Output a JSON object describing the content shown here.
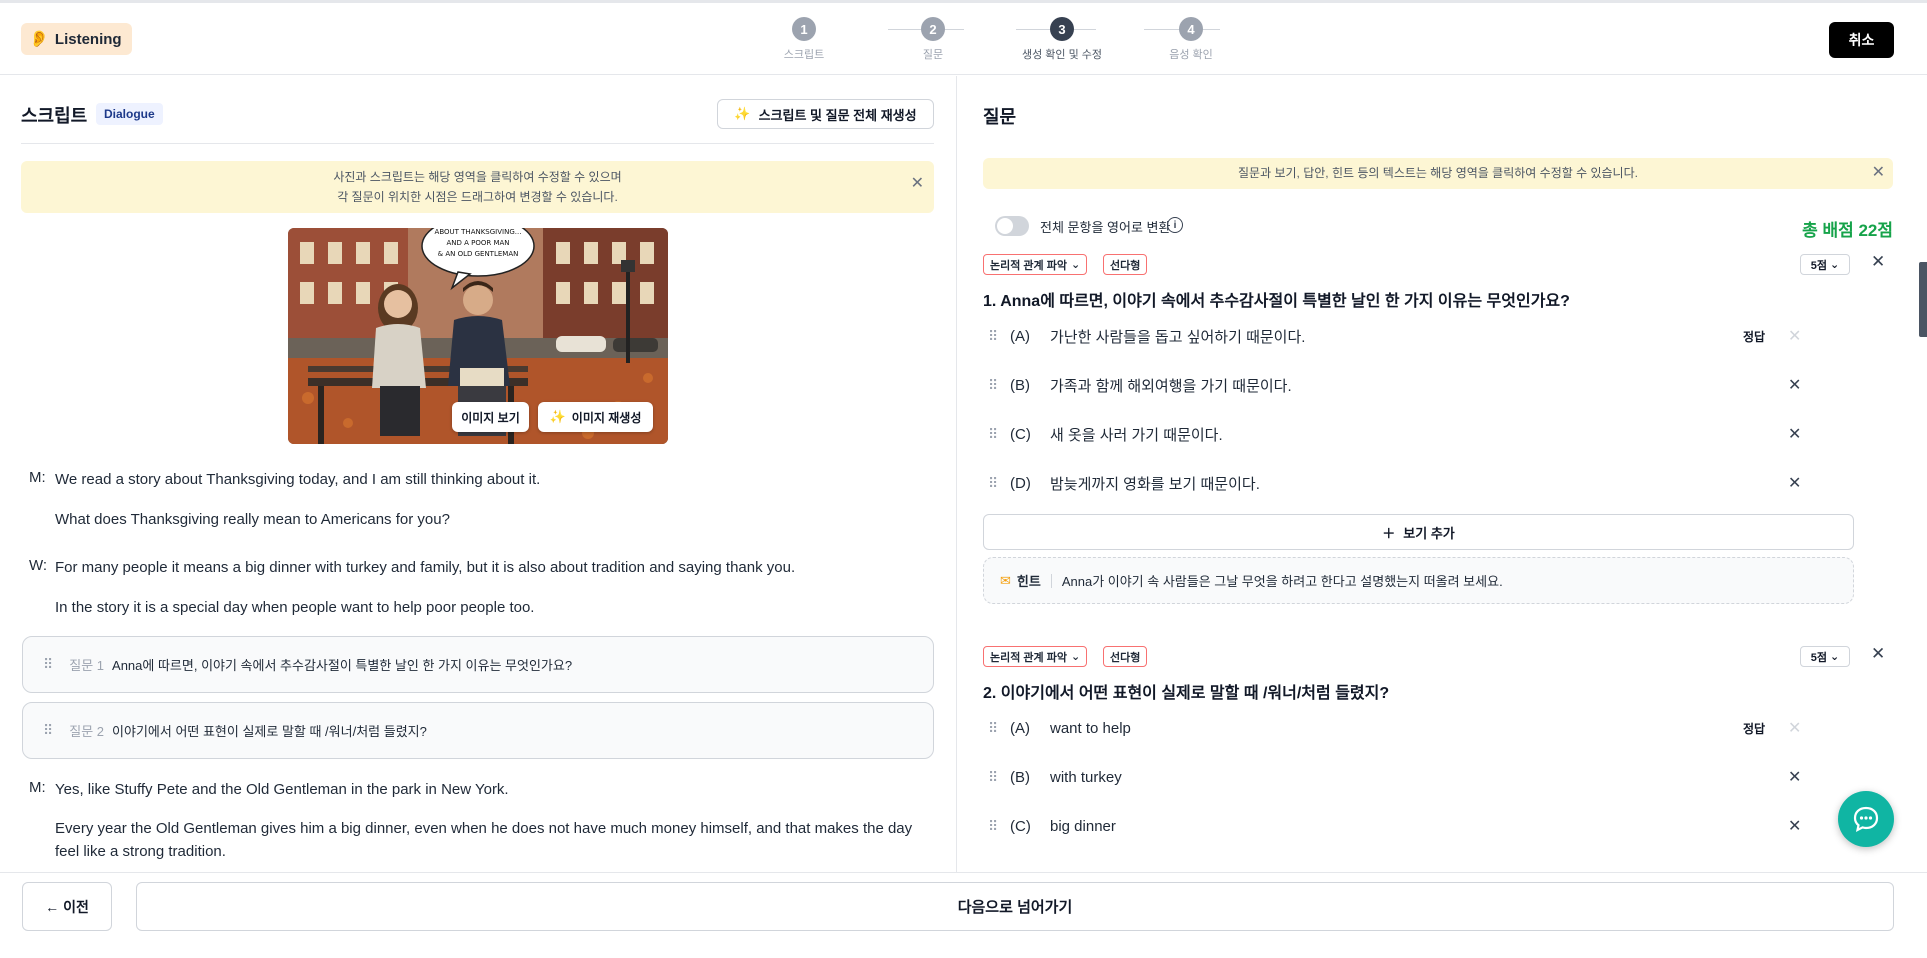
{
  "header": {
    "mode_label": "Listening",
    "steps": [
      {
        "num": "1",
        "label": "스크립트"
      },
      {
        "num": "2",
        "label": "질문"
      },
      {
        "num": "3",
        "label": "생성 확인 및 수정"
      },
      {
        "num": "4",
        "label": "음성 확인"
      }
    ],
    "current_step": 3,
    "cancel_label": "취소"
  },
  "script": {
    "title": "스크립트",
    "type_badge": "Dialogue",
    "regen_all_label": "스크립트 및 질문 전체 재생성",
    "notice_line1": "사진과 스크립트는 해당 영역을 클릭하여 수정할 수 있으며",
    "notice_line2": "각 질문이 위치한 시점은 드래그하여 변경할 수 있습니다.",
    "image": {
      "speech_bubble": [
        "ABOUT THANKSGIVING...",
        "AND A POOR MAN",
        "& AN OLD GENTLEMAN"
      ],
      "view_label": "이미지 보기",
      "regen_label": "이미지 재생성"
    },
    "lines": [
      {
        "speaker": "M:",
        "text": "We read a story about Thanksgiving today, and I am still thinking about it."
      },
      {
        "speaker": "",
        "text": "What does Thanksgiving really mean to Americans for you?"
      },
      {
        "speaker": "W:",
        "text": "For many people it means a big dinner with turkey and family, but it is also about tradition and saying thank you."
      },
      {
        "speaker": "",
        "text": "In the story it is a special day when people want to help poor people too."
      },
      {
        "speaker": "M:",
        "text": "Yes, like Stuffy Pete and the Old Gentleman in the park in New York."
      },
      {
        "speaker": "",
        "text": "Every year the Old Gentleman gives him a big dinner, even when he does not have much money himself, and that makes the day feel like a strong tradition."
      }
    ],
    "question_markers": [
      {
        "label": "질문 1",
        "text": "Anna에 따르면, 이야기 속에서 추수감사절이 특별한 날인 한 가지 이유는 무엇인가요?"
      },
      {
        "label": "질문 2",
        "text": "이야기에서 어떤 표현이 실제로 말할 때 /워너/처럼 들렸지?"
      }
    ]
  },
  "questions_panel": {
    "title": "질문",
    "notice": "질문과 보기, 답안, 힌트 등의 텍스트는 해당 영역을 클릭하여 수정할 수 있습니다.",
    "toggle_label": "전체 문항을 영어로 변환",
    "total_score": "총 배점 22점",
    "add_option_label": "보기 추가",
    "answer_label": "정답",
    "questions": [
      {
        "category": "논리적 관계 파악",
        "type": "선다형",
        "points": "5점",
        "title": "1.  Anna에 따르면, 이야기 속에서 추수감사절이 특별한 날인 한 가지 이유는 무엇인가요?",
        "options": [
          {
            "letter": "(A)",
            "text": "가난한 사람들을 돕고 싶어하기 때문이다.",
            "correct": true
          },
          {
            "letter": "(B)",
            "text": "가족과 함께 해외여행을 가기 때문이다.",
            "correct": false
          },
          {
            "letter": "(C)",
            "text": "새 옷을 사러 가기 때문이다.",
            "correct": false
          },
          {
            "letter": "(D)",
            "text": "밤늦게까지 영화를 보기 때문이다.",
            "correct": false
          }
        ],
        "hint_label": "힌트",
        "hint": "Anna가 이야기 속 사람들은 그날 무엇을 하려고 한다고 설명했는지 떠올려 보세요."
      },
      {
        "category": "논리적 관계 파악",
        "type": "선다형",
        "points": "5점",
        "title": "2.  이야기에서 어떤 표현이 실제로 말할 때 /워너/처럼 들렸지?",
        "options": [
          {
            "letter": "(A)",
            "text": "want to help",
            "correct": true
          },
          {
            "letter": "(B)",
            "text": "with turkey",
            "correct": false
          },
          {
            "letter": "(C)",
            "text": "big dinner",
            "correct": false
          }
        ]
      }
    ]
  },
  "footer": {
    "prev_label": "이전",
    "next_label": "다음으로 넘어가기"
  },
  "colors": {
    "accent_green": "#16a34a",
    "notice_bg": "#fdf6d4",
    "tag_border": "#f87171",
    "chat_fab": "#10b5a3",
    "badge_bg": "#fde9d2"
  }
}
